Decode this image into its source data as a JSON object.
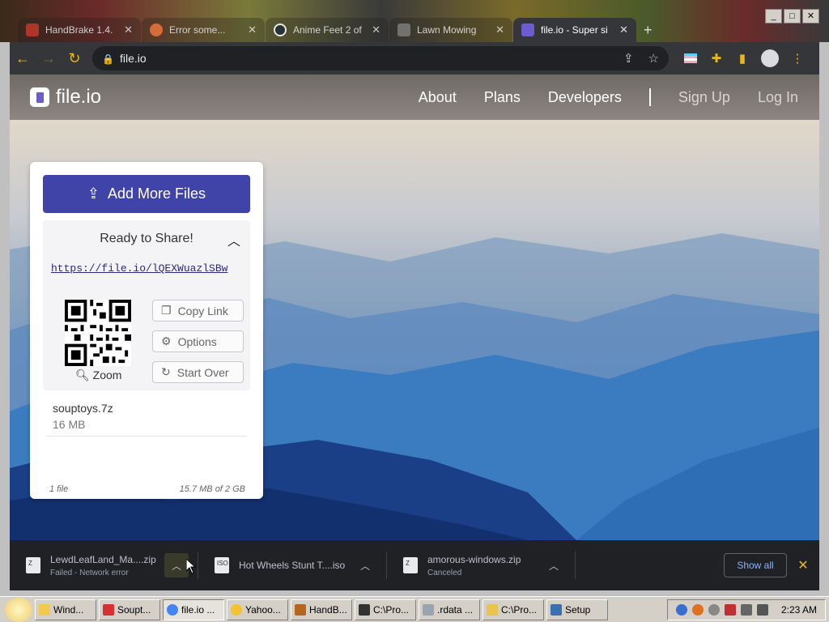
{
  "browser": {
    "tabs": [
      {
        "title": "HandBrake 1.4.",
        "favicon_color": "#c0392b",
        "active": false
      },
      {
        "title": "Error some...",
        "favicon_color": "#e8733a",
        "active": false
      },
      {
        "title": "Anime Feet 2 of",
        "favicon_color": "#1b2838",
        "active": false
      },
      {
        "title": "Lawn Mowing",
        "favicon_color": "#7a7a7a",
        "active": false
      },
      {
        "title": "file.io - Super si",
        "favicon_color": "#6d5bd0",
        "active": true
      }
    ],
    "new_tab_glyph": "+",
    "url": "file.io"
  },
  "site": {
    "logo_text": "file.io",
    "nav": [
      "About",
      "Plans",
      "Developers"
    ],
    "auth": [
      "Sign Up",
      "Log In"
    ]
  },
  "upload_card": {
    "add_button": "Add More Files",
    "share_title": "Ready to Share!",
    "share_link": "https://file.io/lQEXWuazlSBw",
    "zoom_label": "Zoom",
    "actions": [
      "Copy Link",
      "Options",
      "Start Over"
    ],
    "file_name": "souptoys.7z",
    "file_size": "16 MB",
    "file_count": "1 file",
    "quota": "15.7 MB of 2 GB"
  },
  "downloads": [
    {
      "name": "LewdLeafLand_Ma....zip",
      "status": "Failed - Network error",
      "icon_label": "Z"
    },
    {
      "name": "Hot Wheels Stunt T....iso",
      "status": "",
      "icon_label": "ISO"
    },
    {
      "name": "amorous-windows.zip",
      "status": "Canceled",
      "icon_label": "Z"
    }
  ],
  "shelf": {
    "show_all": "Show all"
  },
  "taskbar": {
    "buttons": [
      {
        "label": "Wind...",
        "icon_color": "#f2c94c"
      },
      {
        "label": "Soupt...",
        "icon_color": "#d63030"
      },
      {
        "label": "file.io ...",
        "icon_color": "#4285f4"
      },
      {
        "label": "Yahoo...",
        "icon_color": "#f4c430"
      },
      {
        "label": "HandB...",
        "icon_color": "#b5651d"
      },
      {
        "label": "C:\\Pro...",
        "icon_color": "#333333"
      },
      {
        "label": ".rdata ...",
        "icon_color": "#9aa4b0"
      },
      {
        "label": "C:\\Pro...",
        "icon_color": "#e8c44a"
      },
      {
        "label": "Setup",
        "icon_color": "#3a6fb0"
      }
    ],
    "clock": "2:23 AM"
  }
}
